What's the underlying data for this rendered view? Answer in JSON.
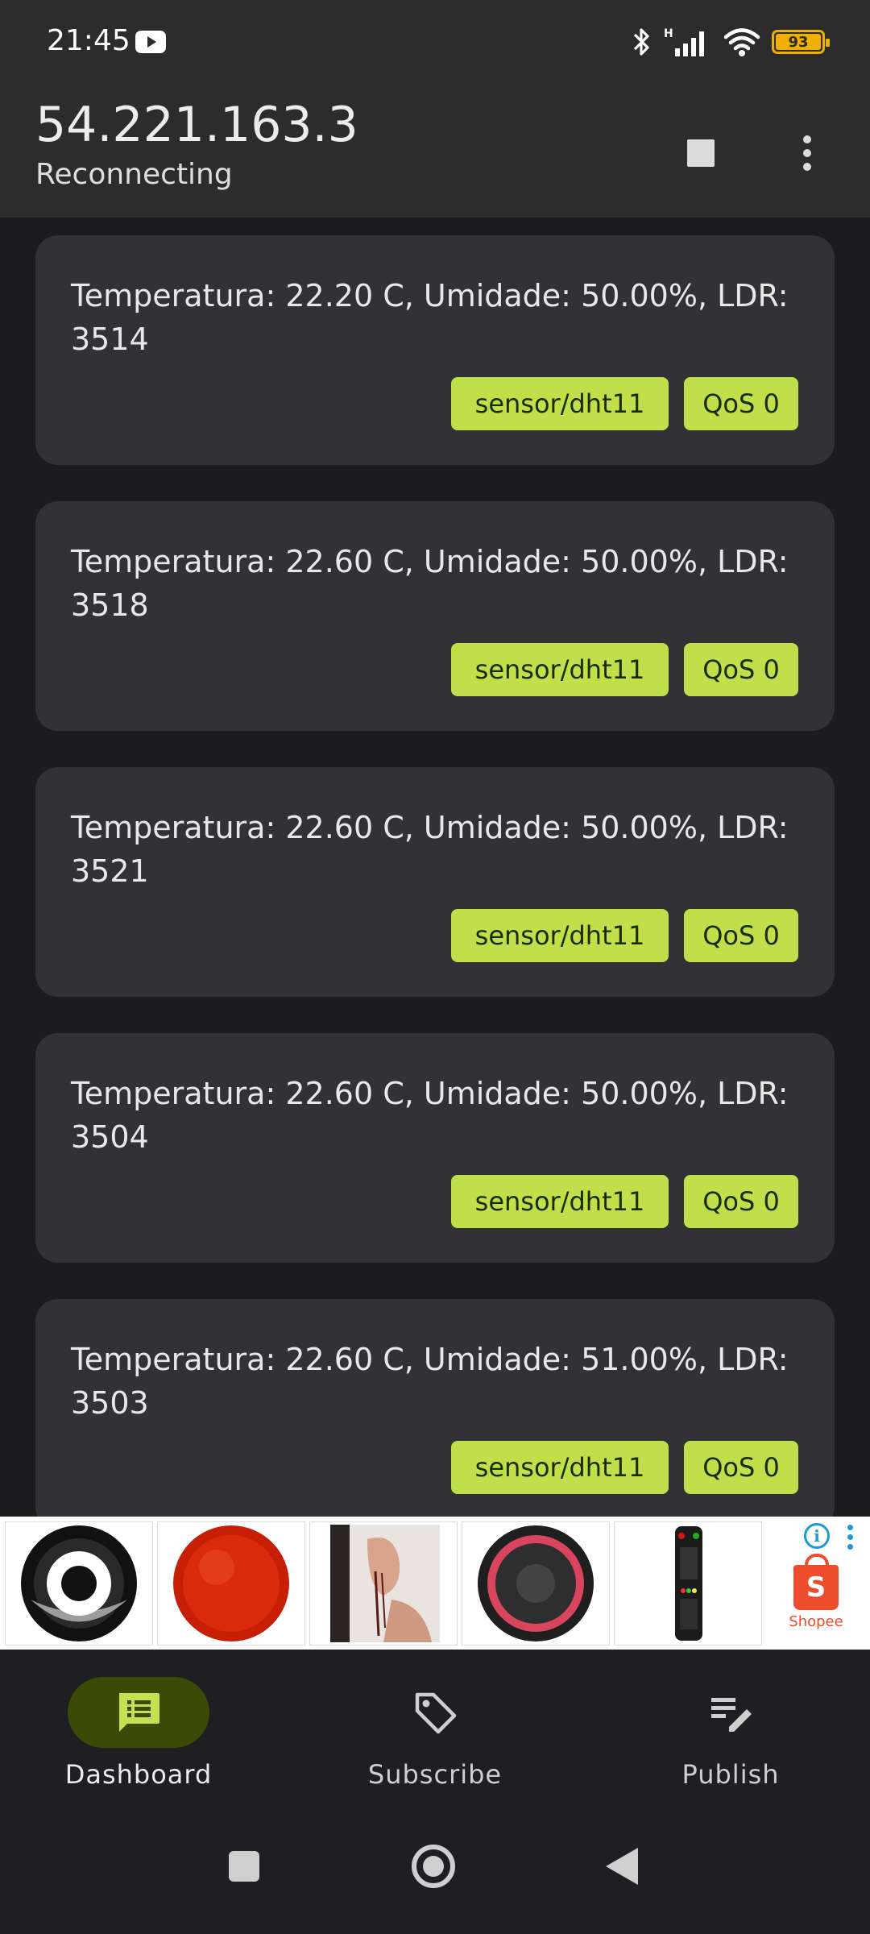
{
  "status_bar": {
    "time": "21:45",
    "battery_level": "93",
    "icons": [
      "youtube-icon",
      "bluetooth-icon",
      "signal-icon",
      "wifi-icon",
      "battery-icon"
    ]
  },
  "app_bar": {
    "title": "54.221.163.3",
    "subtitle": "Reconnecting",
    "actions": [
      "stop-icon",
      "more-vert-icon"
    ]
  },
  "messages": [
    {
      "text": "Temperatura: 22.20 C, Umidade: 50.00%, LDR: 3514",
      "topic": "sensor/dht11",
      "qos": "QoS 0"
    },
    {
      "text": "Temperatura: 22.60 C, Umidade: 50.00%, LDR: 3518",
      "topic": "sensor/dht11",
      "qos": "QoS 0"
    },
    {
      "text": "Temperatura: 22.60 C, Umidade: 50.00%, LDR: 3521",
      "topic": "sensor/dht11",
      "qos": "QoS 0"
    },
    {
      "text": "Temperatura: 22.60 C, Umidade: 50.00%, LDR: 3504",
      "topic": "sensor/dht11",
      "qos": "QoS 0"
    },
    {
      "text": "Temperatura: 22.60 C, Umidade: 51.00%, LDR: 3503",
      "topic": "sensor/dht11",
      "qos": "QoS 0"
    }
  ],
  "ad": {
    "brand": "Shopee",
    "brand_letter": "S",
    "info_glyph": "i",
    "products": [
      "vinyl-record-image",
      "red-disc-image",
      "earring-image",
      "speaker-image",
      "remote-control-image"
    ]
  },
  "bottom_nav": {
    "items": [
      {
        "label": "Dashboard",
        "icon": "dashboard-icon",
        "active": true
      },
      {
        "label": "Subscribe",
        "icon": "tag-icon",
        "active": false
      },
      {
        "label": "Publish",
        "icon": "edit-note-icon",
        "active": false
      }
    ]
  },
  "colors": {
    "background": "#1c1c1e",
    "card": "#323236",
    "chip": "#bfe04a",
    "active_pill": "#3b4a05",
    "battery": "#f0b000",
    "shopee": "#ee4d2d"
  }
}
